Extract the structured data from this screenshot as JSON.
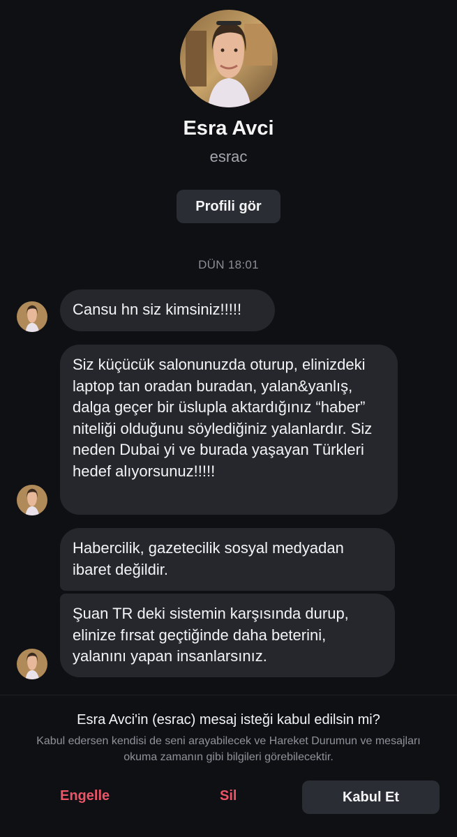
{
  "profile": {
    "name": "Esra Avci",
    "username": "esrac",
    "view_profile_label": "Profili gör"
  },
  "conversation": {
    "timestamp": "DÜN 18:01",
    "messages": [
      {
        "text": "Cansu hn siz kimsiniz!!!!!"
      },
      {
        "text": "Siz küçücük salonunuzda oturup, elinizdeki laptop tan oradan buradan, yalan&yanlış, dalga geçer bir üslupla aktardığınız “haber” niteliği olduğunu söylediğiniz yalanlardır. Siz neden Dubai yi ve burada yaşayan Türkleri hedef alıyorsunuz!!!!!"
      },
      {
        "text": "Habercilik, gazetecilik sosyal medyadan ibaret değildir."
      },
      {
        "text": "Şuan TR deki sistemin karşısında durup, elinize fırsat geçtiğinde daha beterini, yalanını yapan insanlarsınız."
      }
    ]
  },
  "request": {
    "question": "Esra Avci'in (esrac) mesaj isteği kabul edilsin mi?",
    "info": "Kabul edersen kendisi de seni arayabilecek ve Hareket Durumun ve mesajları okuma zamanın gibi bilgileri görebilecektir.",
    "block_label": "Engelle",
    "delete_label": "Sil",
    "accept_label": "Kabul Et"
  },
  "colors": {
    "background": "#0e1014",
    "bubble": "#25272c",
    "button": "#2a2d33",
    "danger": "#ec5567"
  },
  "icons": {
    "avatar": "profile-photo"
  }
}
